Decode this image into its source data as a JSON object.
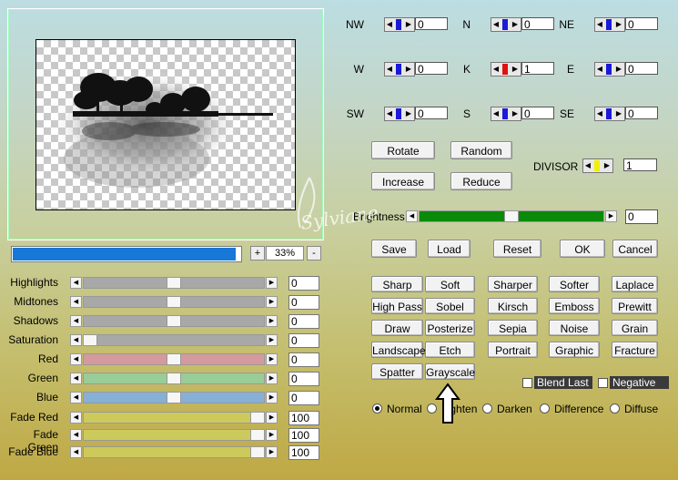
{
  "preview": {
    "zoom": "33%",
    "progress_percent": 98,
    "zoom_plus": "+",
    "zoom_minus": "-"
  },
  "matrix": {
    "rows": [
      [
        {
          "label": "NW",
          "value": "0",
          "color": "#1a1ad8"
        },
        {
          "label": "N",
          "value": "0",
          "color": "#1a1ad8"
        },
        {
          "label": "NE",
          "value": "0",
          "color": "#1a1ad8"
        }
      ],
      [
        {
          "label": "W",
          "value": "0",
          "color": "#1a1ad8"
        },
        {
          "label": "K",
          "value": "1",
          "color": "#e01010"
        },
        {
          "label": "E",
          "value": "0",
          "color": "#1a1ad8"
        }
      ],
      [
        {
          "label": "SW",
          "value": "0",
          "color": "#1a1ad8"
        },
        {
          "label": "S",
          "value": "0",
          "color": "#1a1ad8"
        },
        {
          "label": "SE",
          "value": "0",
          "color": "#1a1ad8"
        }
      ]
    ],
    "divisor_label": "DIVISOR",
    "divisor_value": "1",
    "divisor_color": "#f0f000"
  },
  "buttons": {
    "rotate": "Rotate",
    "random": "Random",
    "increase": "Increase",
    "reduce": "Reduce",
    "save": "Save",
    "load": "Load",
    "reset": "Reset",
    "ok": "OK",
    "cancel": "Cancel"
  },
  "brightness": {
    "label": "Brightness",
    "value": "0",
    "track_color": "#0a8a0a",
    "level_percent": 50
  },
  "filters": [
    [
      "Sharp",
      "Soft",
      "Sharper",
      "Softer",
      "Laplace"
    ],
    [
      "High Pass",
      "Sobel",
      "Kirsch",
      "Emboss",
      "Prewitt"
    ],
    [
      "Draw",
      "Posterize",
      "Sepia",
      "Noise",
      "Grain"
    ],
    [
      "Landscape",
      "Etch",
      "Portrait",
      "Graphic",
      "Fracture"
    ],
    [
      "Spatter",
      "Grayscale"
    ]
  ],
  "options": {
    "blend_last": "Blend Last",
    "negative": "Negative"
  },
  "modes": [
    {
      "label": "Normal",
      "selected": true
    },
    {
      "label": "Lighten",
      "selected": false
    },
    {
      "label": "Darken",
      "selected": false
    },
    {
      "label": "Difference",
      "selected": false
    },
    {
      "label": "Diffuse",
      "selected": false
    }
  ],
  "sliders": [
    {
      "label": "Highlights",
      "value": "0",
      "color": "#a8a8a8",
      "level_percent": 50
    },
    {
      "label": "Midtones",
      "value": "0",
      "color": "#a8a8a8",
      "level_percent": 50
    },
    {
      "label": "Shadows",
      "value": "0",
      "color": "#a8a8a8",
      "level_percent": 50
    },
    {
      "label": "Saturation",
      "value": "0",
      "color": "#a8a8a8",
      "level_percent": 0
    },
    {
      "label": "Red",
      "value": "0",
      "color": "#d49a9e",
      "level_percent": 50
    },
    {
      "label": "Green",
      "value": "0",
      "color": "#98cc98",
      "level_percent": 50
    },
    {
      "label": "Blue",
      "value": "0",
      "color": "#86b0d6",
      "level_percent": 50
    },
    {
      "label": "Fade Red",
      "value": "100",
      "color": "#cdca5c",
      "level_percent": 100
    },
    {
      "label": "Fade Green",
      "value": "100",
      "color": "#cdca5c",
      "level_percent": 100
    },
    {
      "label": "Fade Blue",
      "value": "100",
      "color": "#cdca5c",
      "level_percent": 100
    }
  ],
  "watermark": "Sylviane"
}
